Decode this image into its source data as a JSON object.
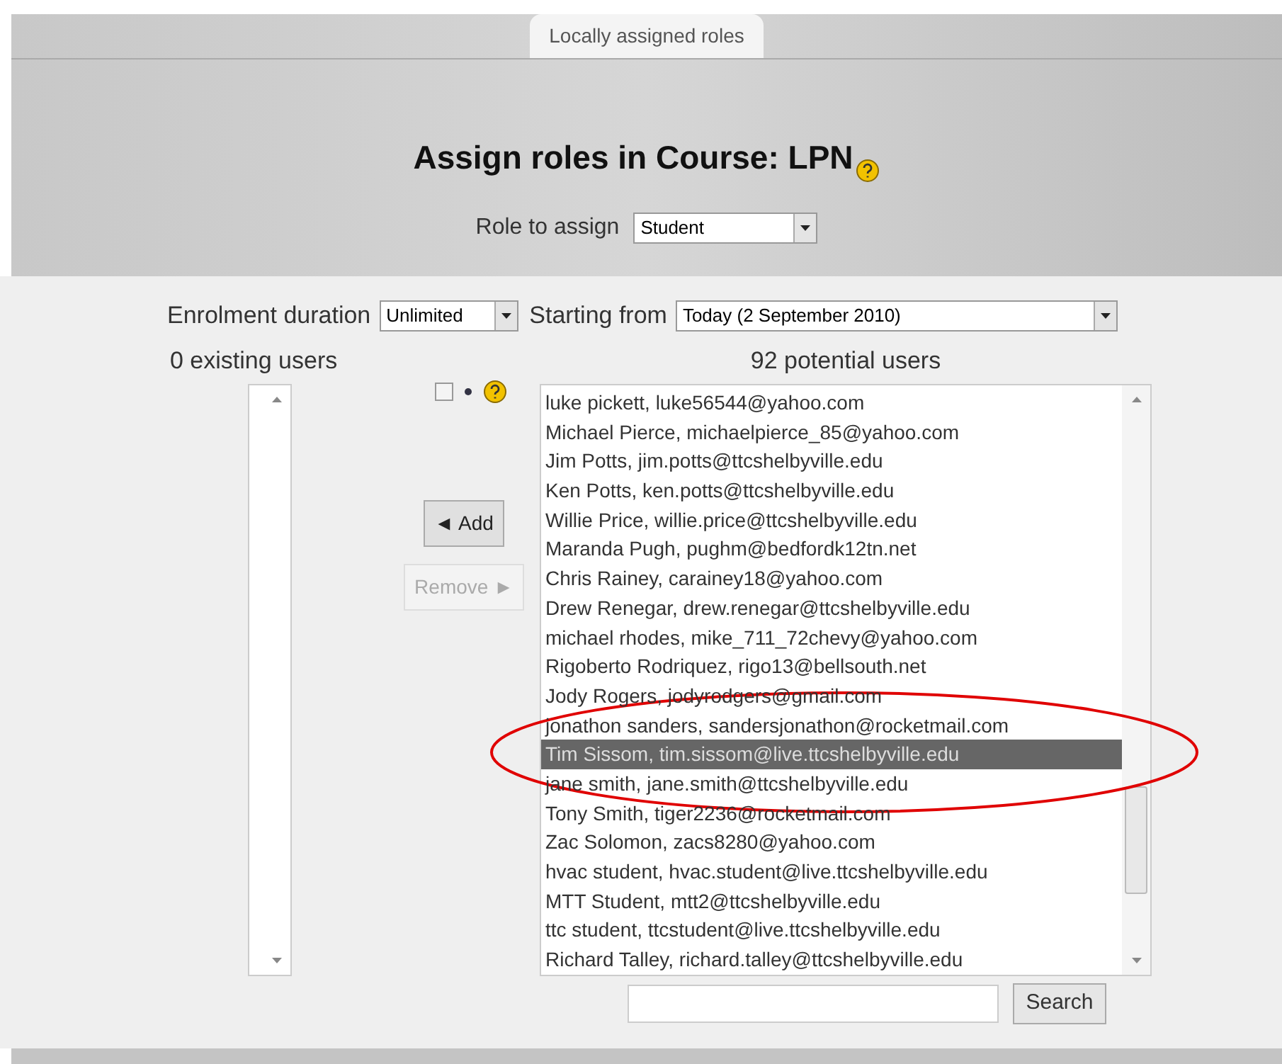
{
  "tabs": [
    {
      "label": "Locally assigned roles",
      "selected": true
    }
  ],
  "title": "Assign roles in Course: LPN",
  "role_to_assign": {
    "label": "Role to assign",
    "value": "Student"
  },
  "enrolment_duration": {
    "label": "Enrolment duration",
    "value": "Unlimited"
  },
  "starting_from": {
    "label": "Starting from",
    "value": "Today (2 September 2010)"
  },
  "existing_users": {
    "heading": "0 existing users"
  },
  "options": {
    "checked": false
  },
  "buttons": [
    {
      "label": "◄ Add",
      "disabled": false
    },
    {
      "label": "Remove ►",
      "disabled": true
    }
  ],
  "potential_users": {
    "heading": "92 potential users",
    "items": [
      {
        "text": "luke pickett, luke56544@yahoo.com",
        "selected": false
      },
      {
        "text": "Michael Pierce, michaelpierce_85@yahoo.com",
        "selected": false
      },
      {
        "text": "Jim Potts, jim.potts@ttcshelbyville.edu",
        "selected": false
      },
      {
        "text": "Ken Potts, ken.potts@ttcshelbyville.edu",
        "selected": false
      },
      {
        "text": "Willie Price, willie.price@ttcshelbyville.edu",
        "selected": false
      },
      {
        "text": "Maranda Pugh, pughm@bedfordk12tn.net",
        "selected": false
      },
      {
        "text": "Chris Rainey, carainey18@yahoo.com",
        "selected": false
      },
      {
        "text": "Drew Renegar, drew.renegar@ttcshelbyville.edu",
        "selected": false
      },
      {
        "text": "michael rhodes, mike_711_72chevy@yahoo.com",
        "selected": false
      },
      {
        "text": "Rigoberto Rodriquez, rigo13@bellsouth.net",
        "selected": false
      },
      {
        "text": "Jody Rogers, jodyrodgers@gmail.com",
        "selected": false
      },
      {
        "text": "jonathon sanders, sandersjonathon@rocketmail.com",
        "selected": false
      },
      {
        "text": "Tim Sissom, tim.sissom@live.ttcshelbyville.edu",
        "selected": true
      },
      {
        "text": "jane smith, jane.smith@ttcshelbyville.edu",
        "selected": false
      },
      {
        "text": "Tony Smith, tiger2236@rocketmail.com",
        "selected": false
      },
      {
        "text": "Zac Solomon, zacs8280@yahoo.com",
        "selected": false
      },
      {
        "text": "hvac student, hvac.student@live.ttcshelbyville.edu",
        "selected": false
      },
      {
        "text": "MTT Student, mtt2@ttcshelbyville.edu",
        "selected": false
      },
      {
        "text": "ttc student, ttcstudent@live.ttcshelbyville.edu",
        "selected": false
      },
      {
        "text": "Richard Talley, richard.talley@ttcshelbyville.edu",
        "selected": false
      }
    ]
  },
  "search": {
    "button": "Search"
  }
}
